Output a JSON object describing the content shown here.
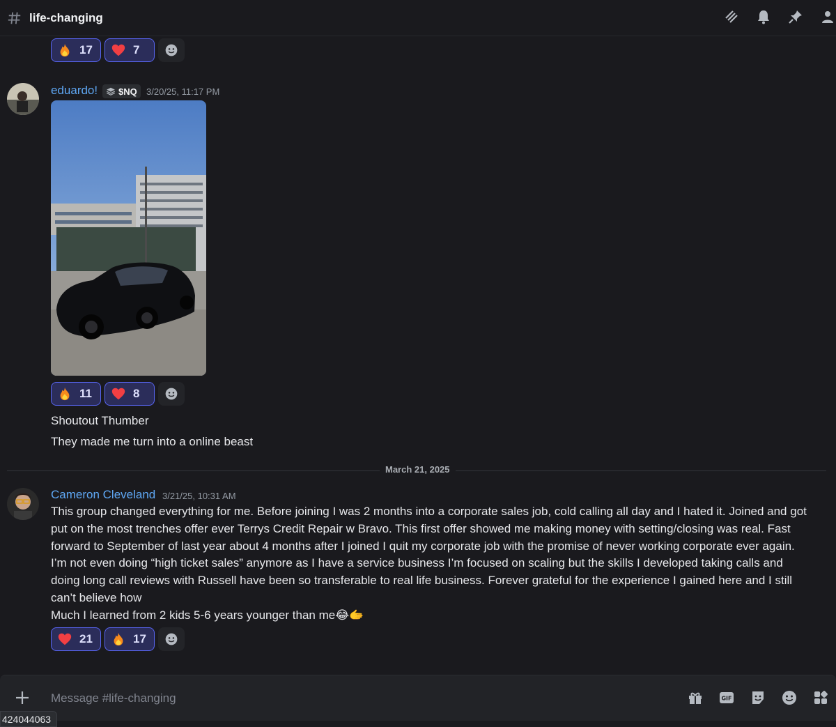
{
  "channel": {
    "name": "life-changing",
    "composer_placeholder": "Message #life-changing"
  },
  "colors": {
    "accent": "#5865f2",
    "username_blue": "#5fa8f5"
  },
  "top_reactions": [
    {
      "emoji": "fire-emoji",
      "count": "17"
    },
    {
      "emoji": "heart-emoji",
      "count": "7"
    }
  ],
  "messages": [
    {
      "author": "eduardo!",
      "tag": "$NQ",
      "timestamp": "3/20/25, 11:17 PM",
      "attachment": "car-photo",
      "reactions": [
        {
          "emoji": "fire-emoji",
          "count": "11"
        },
        {
          "emoji": "heart-emoji",
          "count": "8"
        }
      ],
      "lines": [
        "Shoutout Thumber",
        "They made me turn into a online beast"
      ]
    },
    {
      "author": "Cameron Cleveland",
      "timestamp": "3/21/25, 10:31 AM",
      "lines": [
        "This group changed everything for me. Before joining I was 2 months into a corporate sales job, cold calling all day and I hated it. Joined and got",
        "put on the most trenches offer ever Terrys Credit Repair w Bravo. This first offer showed me making money with setting/closing was real. Fast",
        "forward to September of last year about 4 months after I joined I quit my corporate job with the promise of never working corporate ever again.",
        "I’m not even doing “high ticket sales” anymore as I have a service business I’m focused on scaling but the skills I developed taking calls and",
        "doing long call reviews with Russell have been so transferable to real life business. Forever grateful for the experience I gained here and I still",
        "can’t believe how",
        "Much I learned from 2 kids 5-6 years younger than me😂🫱"
      ],
      "reactions": [
        {
          "emoji": "heart-emoji",
          "count": "21"
        },
        {
          "emoji": "fire-emoji",
          "count": "17"
        }
      ]
    }
  ],
  "date_divider": "March 21, 2025",
  "id_badge": "424044063"
}
